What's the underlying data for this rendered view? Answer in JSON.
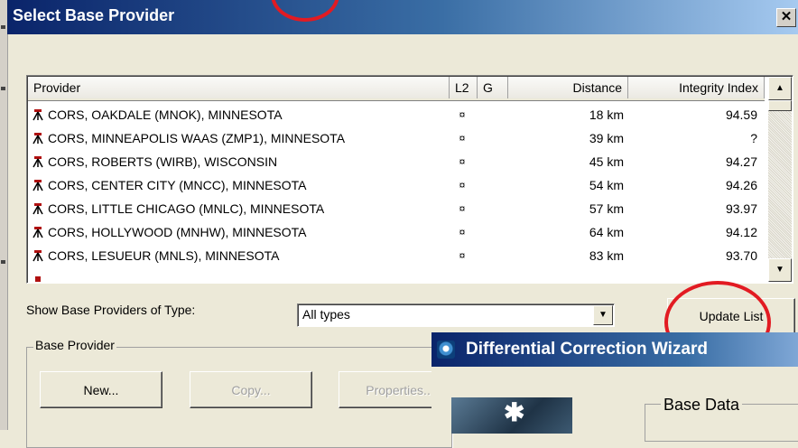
{
  "dialog": {
    "title": "Select Base Provider",
    "close_glyph": "✕"
  },
  "list": {
    "columns": [
      "Provider",
      "L2",
      "G",
      "Distance",
      "Integrity Index"
    ],
    "rows": [
      {
        "provider": "CORS, OAKDALE (MNOK),  MINNESOTA",
        "l2": "¤",
        "distance": "18 km",
        "integrity": "94.59"
      },
      {
        "provider": "CORS, MINNEAPOLIS WAAS (ZMP1),  MINNESOTA",
        "l2": "¤",
        "distance": "39 km",
        "integrity": "?"
      },
      {
        "provider": "CORS, ROBERTS (WIRB),  WISCONSIN",
        "l2": "¤",
        "distance": "45 km",
        "integrity": "94.27"
      },
      {
        "provider": "CORS, CENTER CITY (MNCC),  MINNESOTA",
        "l2": "¤",
        "distance": "54 km",
        "integrity": "94.26"
      },
      {
        "provider": "CORS, LITTLE CHICAGO (MNLC),  MINNESOTA",
        "l2": "¤",
        "distance": "57 km",
        "integrity": "93.97"
      },
      {
        "provider": "CORS, HOLLYWOOD (MNHW),  MINNESOTA",
        "l2": "¤",
        "distance": "64 km",
        "integrity": "94.12"
      },
      {
        "provider": "CORS, LESUEUR (MNLS),  MINNESOTA",
        "l2": "¤",
        "distance": "83 km",
        "integrity": "93.70"
      }
    ],
    "row_icon": "surveyor-tripod-icon"
  },
  "filter": {
    "label": "Show Base Providers of Type:",
    "selected": "All types"
  },
  "buttons": {
    "update_list": "Update List",
    "new": "New...",
    "copy": "Copy...",
    "properties": "Properties..."
  },
  "group": {
    "label": "Base Provider"
  },
  "wizard": {
    "title": "Differential Correction Wizard",
    "base_data_label": "Base Data"
  },
  "colors": {
    "highlight_circle": "#e21b22",
    "titlebar": "#0a246a",
    "window_bg": "#ece9d8"
  }
}
